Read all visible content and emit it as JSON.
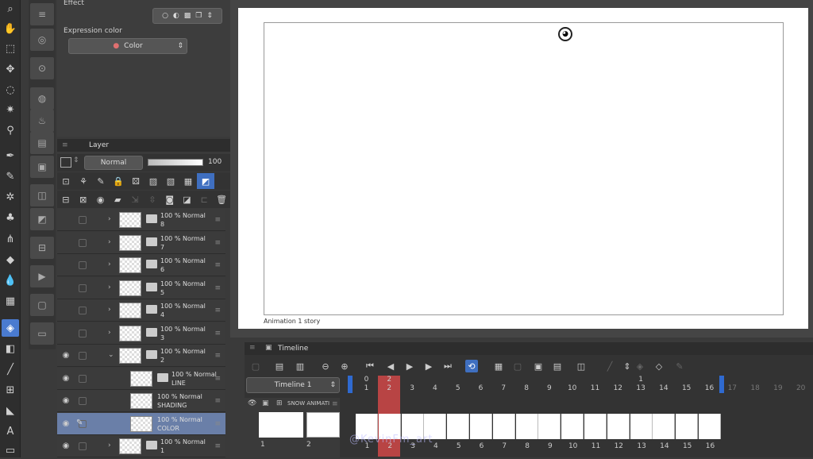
{
  "properties": {
    "effect_label": "Effect",
    "expression_label": "Expression color",
    "expression_value": "Color"
  },
  "layer_panel": {
    "tab_label": "Layer",
    "blend_mode": "Normal",
    "opacity": "100",
    "layers": [
      {
        "line1": "100 %  Normal",
        "line2": "8",
        "visible": false
      },
      {
        "line1": "100 %  Normal",
        "line2": "7",
        "visible": false
      },
      {
        "line1": "100 %  Normal",
        "line2": "6",
        "visible": false
      },
      {
        "line1": "100 %  Normal",
        "line2": "5",
        "visible": false
      },
      {
        "line1": "100 %  Normal",
        "line2": "4",
        "visible": false
      },
      {
        "line1": "100 %  Normal",
        "line2": "3",
        "visible": false
      },
      {
        "line1": "100 %  Normal",
        "line2": "2",
        "visible": true
      },
      {
        "line1": "100 %  Normal",
        "line2": "LINE",
        "visible": true
      },
      {
        "line1": "100 %  Normal",
        "line2": "SHADING",
        "visible": true
      },
      {
        "line1": "100 %  Normal",
        "line2": "COLOR",
        "visible": true
      },
      {
        "line1": "100 %  Normal",
        "line2": "1",
        "visible": true
      }
    ]
  },
  "canvas": {
    "story_label": "Animation 1 story"
  },
  "timeline": {
    "tab_label": "Timeline",
    "name": "Timeline 1",
    "track_name": "SNOW ANIMATI",
    "top_numbers": [
      "0",
      "2",
      "",
      "",
      "",
      "",
      "",
      "",
      "",
      "",
      "",
      "",
      "1",
      "",
      "",
      ""
    ],
    "top_sub": [
      "1",
      "2",
      "3",
      "4",
      "5",
      "6",
      "7",
      "8",
      "9",
      "10",
      "11",
      "12",
      "13",
      "14",
      "15",
      "16",
      "17",
      "18",
      "19",
      "20"
    ],
    "cell_numbers": [
      "1",
      "2",
      "3",
      "4",
      "5",
      "6",
      "7",
      "8",
      "9",
      "10",
      "11",
      "12",
      "13",
      "14",
      "15",
      "16"
    ],
    "left_numbers": [
      "1",
      "2"
    ],
    "accent_color": "#d04848",
    "watermark": "@KevinFm_art"
  }
}
